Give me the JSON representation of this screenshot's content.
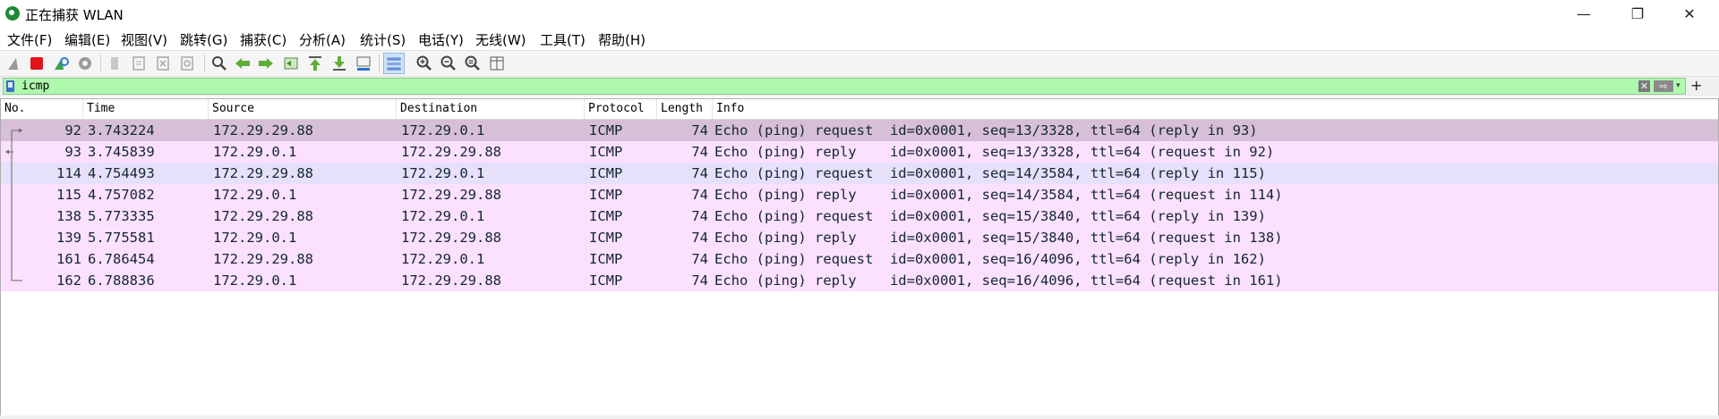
{
  "window": {
    "title": "正在捕获 WLAN",
    "controls": {
      "minimize": "—",
      "restore": "❐",
      "close": "✕"
    }
  },
  "menu": [
    "文件(F)",
    "编辑(E)",
    "视图(V)",
    "跳转(G)",
    "捕获(C)",
    "分析(A)",
    "统计(S)",
    "电话(Y)",
    "无线(W)",
    "工具(T)",
    "帮助(H)"
  ],
  "toolbar": {
    "icons": [
      "shark-fin-start-icon",
      "stop-capture-icon",
      "restart-capture-icon",
      "capture-options-icon",
      "open-file-icon",
      "save-file-icon",
      "close-file-icon",
      "reload-file-icon",
      "find-packet-icon",
      "go-back-icon",
      "go-forward-icon",
      "go-to-packet-icon",
      "go-first-icon",
      "go-last-icon",
      "autoscroll-icon",
      "colorize-icon",
      "zoom-in-icon",
      "zoom-out-icon",
      "zoom-normal-icon",
      "resize-columns-icon"
    ]
  },
  "filter": {
    "value": "icmp",
    "clear_label": "✕",
    "apply_label": "⇨",
    "dropdown_label": "▾",
    "add_label": "+"
  },
  "packet_list": {
    "columns": [
      "No.",
      "Time",
      "Source",
      "Destination",
      "Protocol",
      "Length",
      "Info"
    ],
    "colors": {
      "selected_related": "#d8bfd8",
      "icmp": "#fce0ff",
      "alt": "#e6e0fb"
    },
    "rows": [
      {
        "no": "92",
        "time": "3.743224",
        "source": "172.29.29.88",
        "destination": "172.29.0.1",
        "protocol": "ICMP",
        "length": "74",
        "info": "Echo (ping) request  id=0x0001, seq=13/3328, ttl=64 (reply in 93)",
        "style": "selected_related",
        "marker": "request"
      },
      {
        "no": "93",
        "time": "3.745839",
        "source": "172.29.0.1",
        "destination": "172.29.29.88",
        "protocol": "ICMP",
        "length": "74",
        "info": "Echo (ping) reply    id=0x0001, seq=13/3328, ttl=64 (request in 92)",
        "style": "icmp",
        "marker": "reply"
      },
      {
        "no": "114",
        "time": "4.754493",
        "source": "172.29.29.88",
        "destination": "172.29.0.1",
        "protocol": "ICMP",
        "length": "74",
        "info": "Echo (ping) request  id=0x0001, seq=14/3584, ttl=64 (reply in 115)",
        "style": "alt",
        "marker": "line"
      },
      {
        "no": "115",
        "time": "4.757082",
        "source": "172.29.0.1",
        "destination": "172.29.29.88",
        "protocol": "ICMP",
        "length": "74",
        "info": "Echo (ping) reply    id=0x0001, seq=14/3584, ttl=64 (request in 114)",
        "style": "icmp",
        "marker": "line"
      },
      {
        "no": "138",
        "time": "5.773335",
        "source": "172.29.29.88",
        "destination": "172.29.0.1",
        "protocol": "ICMP",
        "length": "74",
        "info": "Echo (ping) request  id=0x0001, seq=15/3840, ttl=64 (reply in 139)",
        "style": "icmp",
        "marker": "line"
      },
      {
        "no": "139",
        "time": "5.775581",
        "source": "172.29.0.1",
        "destination": "172.29.29.88",
        "protocol": "ICMP",
        "length": "74",
        "info": "Echo (ping) reply    id=0x0001, seq=15/3840, ttl=64 (request in 138)",
        "style": "icmp",
        "marker": "line"
      },
      {
        "no": "161",
        "time": "6.786454",
        "source": "172.29.29.88",
        "destination": "172.29.0.1",
        "protocol": "ICMP",
        "length": "74",
        "info": "Echo (ping) request  id=0x0001, seq=16/4096, ttl=64 (reply in 162)",
        "style": "icmp",
        "marker": "line"
      },
      {
        "no": "162",
        "time": "6.788836",
        "source": "172.29.0.1",
        "destination": "172.29.29.88",
        "protocol": "ICMP",
        "length": "74",
        "info": "Echo (ping) reply    id=0x0001, seq=16/4096, ttl=64 (request in 161)",
        "style": "icmp",
        "marker": "end"
      }
    ]
  }
}
